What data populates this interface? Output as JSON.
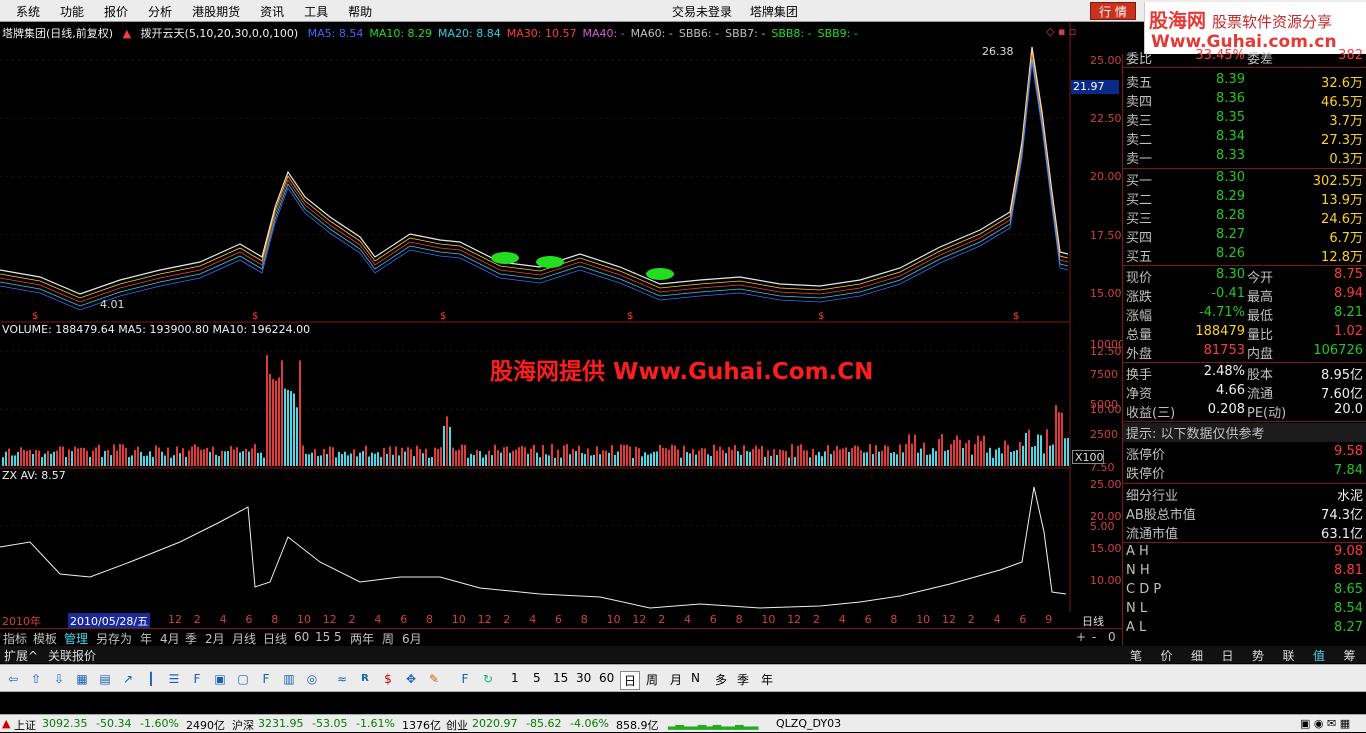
{
  "menu": {
    "items": [
      "系统",
      "功能",
      "报价",
      "分析",
      "港股期货",
      "资讯",
      "工具",
      "帮助"
    ],
    "login_status": "交易未登录",
    "stock_title": "塔牌集团",
    "quote_button": "行 情"
  },
  "logo": {
    "name_a": "股海网",
    "name_b": "股票软件资源分享",
    "url": "Www.Guhai.com.cn"
  },
  "main_chart": {
    "title": "塔牌集团(日线,前复权)",
    "indicator": "拨开云天(5,10,20,30,0,0,100)",
    "ma_values": [
      {
        "label": "MA5: 8.54",
        "color": "#3a6bff"
      },
      {
        "label": "MA10: 8.29",
        "color": "#22dd22"
      },
      {
        "label": "MA20: 8.84",
        "color": "#29d3e8"
      },
      {
        "label": "MA30: 10.57",
        "color": "#ff3b3b"
      },
      {
        "label": "MA40: -",
        "color": "#d65bd6"
      },
      {
        "label": "MA60: -",
        "color": "#c0c0c0"
      },
      {
        "label": "SBB6: -",
        "color": "#c0c0c0"
      },
      {
        "label": "SBB7: -",
        "color": "#c0c0c0"
      },
      {
        "label": "SBB8: -",
        "color": "#22dd22"
      },
      {
        "label": "SBB9: -",
        "color": "#22dd22"
      }
    ],
    "price_ticks": [
      "25.00",
      "22.50",
      "20.00",
      "17.50",
      "15.00",
      "12.50",
      "10.00",
      "7.50",
      "5.00"
    ],
    "current_price_label": "21.97",
    "high_label": "26.38",
    "low_label": "4.01"
  },
  "volume_chart": {
    "title": "VOLUME: 188479.64  MA5: 193900.80  MA10: 196224.00",
    "ticks": [
      "10000",
      "7500",
      "5000",
      "2500"
    ],
    "unit": "X100"
  },
  "zx_chart": {
    "title": "ZX AV: 8.57",
    "ticks": [
      "25.00",
      "20.00",
      "15.00",
      "10.00"
    ]
  },
  "watermark": "股海网提供 Www.Guhai.Com.CN",
  "date_axis": {
    "year": "2010年",
    "cursor_date": "2010/05/28/五",
    "months": [
      "12",
      "2",
      "4",
      "6",
      "8",
      "10",
      "12",
      "2",
      "4",
      "6",
      "8",
      "10",
      "12",
      "2",
      "4",
      "6",
      "8",
      "10",
      "12",
      "2",
      "4",
      "6",
      "8",
      "10",
      "12",
      "2",
      "4",
      "6",
      "8",
      "10",
      "12",
      "2",
      "4",
      "6",
      "9"
    ],
    "right_label": "日线"
  },
  "tabs": {
    "items": [
      "指标",
      "模板",
      "管理",
      "另存为",
      "年",
      "4月",
      "季",
      "2月",
      "月线",
      "日线",
      "60",
      "15",
      "5",
      "两年",
      "周",
      "6月"
    ],
    "right": [
      "+",
      "-",
      "0"
    ]
  },
  "subtabs": [
    "扩展^",
    "关联报价"
  ],
  "right_tabs": [
    "笔",
    "价",
    "细",
    "日",
    "势",
    "联",
    "值",
    "筹"
  ],
  "quote_panel": {
    "top_partial": {
      "label": "委比",
      "value": "33.45%",
      "label2": "委差",
      "value2": "382"
    },
    "sell": [
      {
        "label": "卖五",
        "price": "8.39",
        "vol": "32.6万"
      },
      {
        "label": "卖四",
        "price": "8.36",
        "vol": "46.5万"
      },
      {
        "label": "卖三",
        "price": "8.35",
        "vol": "3.7万"
      },
      {
        "label": "卖二",
        "price": "8.34",
        "vol": "27.3万"
      },
      {
        "label": "卖一",
        "price": "8.33",
        "vol": "0.3万"
      }
    ],
    "buy": [
      {
        "label": "买一",
        "price": "8.30",
        "vol": "302.5万"
      },
      {
        "label": "买二",
        "price": "8.29",
        "vol": "13.9万"
      },
      {
        "label": "买三",
        "price": "8.28",
        "vol": "24.6万"
      },
      {
        "label": "买四",
        "price": "8.27",
        "vol": "6.7万"
      },
      {
        "label": "买五",
        "price": "8.26",
        "vol": "12.8万"
      }
    ],
    "stats": [
      {
        "l1": "现价",
        "v1": "8.30",
        "c1": "green",
        "l2": "今开",
        "v2": "8.75",
        "c2": "red"
      },
      {
        "l1": "涨跌",
        "v1": "-0.41",
        "c1": "green",
        "l2": "最高",
        "v2": "8.94",
        "c2": "red"
      },
      {
        "l1": "涨幅",
        "v1": "-4.71%",
        "c1": "green",
        "l2": "最低",
        "v2": "8.21",
        "c2": "green"
      },
      {
        "l1": "总量",
        "v1": "188479",
        "c1": "yellow",
        "l2": "量比",
        "v2": "1.02",
        "c2": "red"
      },
      {
        "l1": "外盘",
        "v1": "81753",
        "c1": "red",
        "l2": "内盘",
        "v2": "106726",
        "c2": "green"
      }
    ],
    "fund": [
      {
        "l1": "换手",
        "v1": "2.48%",
        "l2": "股本",
        "v2": "8.95亿"
      },
      {
        "l1": "净资",
        "v1": "4.66",
        "l2": "流通",
        "v2": "7.60亿"
      },
      {
        "l1": "收益(三)",
        "v1": "0.208",
        "l2": "PE(动)",
        "v2": "20.0"
      }
    ],
    "hint": "提示: 以下数据仅供参考",
    "limits": [
      {
        "label": "涨停价",
        "value": "9.58",
        "color": "red"
      },
      {
        "label": "跌停价",
        "value": "7.84",
        "color": "green"
      }
    ],
    "industry": [
      {
        "label": "细分行业",
        "value": "水泥"
      },
      {
        "label": "AB股总市值",
        "value": "74.3亿"
      },
      {
        "label": "流通市值",
        "value": "63.1亿"
      }
    ],
    "levels": [
      {
        "label": "A H",
        "value": "9.08",
        "color": "red"
      },
      {
        "label": "N H",
        "value": "8.81",
        "color": "red"
      },
      {
        "label": "C D P",
        "value": "8.65",
        "color": "green"
      },
      {
        "label": "N L",
        "value": "8.54",
        "color": "green"
      },
      {
        "label": "A L",
        "value": "8.27",
        "color": "green"
      }
    ]
  },
  "toolbar": {
    "periods": [
      "1",
      "5",
      "15",
      "30",
      "60",
      "日",
      "周",
      "月",
      "N",
      "多",
      "季",
      "年"
    ],
    "active_period": "日"
  },
  "statusbar": {
    "sh": {
      "label": "上证",
      "value": "3092.35",
      "chg": "-50.34",
      "pct": "-1.60%",
      "amt": "2490亿"
    },
    "sz": {
      "label": "沪深",
      "value": "3231.95",
      "chg": "-53.05",
      "pct": "-1.61%",
      "amt": "1376亿"
    },
    "cy": {
      "label": "创业",
      "value": "2020.97",
      "chg": "-85.62",
      "pct": "-4.06%",
      "amt": "858.9亿"
    },
    "server": "QLZQ_DY03"
  }
}
